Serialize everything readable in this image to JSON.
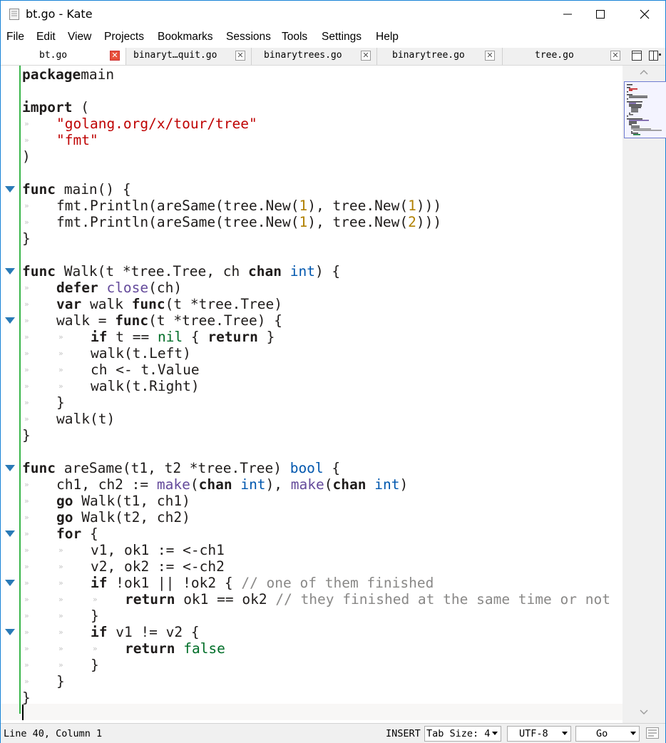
{
  "window": {
    "title": "bt.go  - Kate",
    "controls": {
      "minimize": "minimize",
      "maximize": "maximize",
      "close": "close"
    }
  },
  "menu": [
    "File",
    "Edit",
    "View",
    "Projects",
    "Bookmarks",
    "Sessions",
    "Tools",
    "Settings",
    "Help"
  ],
  "tabs": [
    {
      "label": "bt.go",
      "active": true
    },
    {
      "label": "binaryt…quit.go",
      "active": false
    },
    {
      "label": "binarytrees.go",
      "active": false
    },
    {
      "label": "binarytree.go",
      "active": false
    },
    {
      "label": "tree.go",
      "active": false
    }
  ],
  "editor": {
    "colors": {
      "keyword": "#1f1c1b",
      "string": "#bf0303",
      "number": "#b08000",
      "builtin": "#644a9b",
      "type": "#0057ae",
      "constant": "#006e28",
      "comment": "#898887",
      "fold_marker": "#2a7ab7",
      "modified_line": "#39b54a"
    },
    "lines": [
      {
        "indent": 0,
        "fold": false,
        "tokens": [
          [
            "kw",
            "package"
          ],
          [
            "",
            "main"
          ]
        ]
      },
      {
        "indent": 0,
        "fold": false,
        "tokens": []
      },
      {
        "indent": 0,
        "fold": false,
        "tokens": [
          [
            "kw",
            "import"
          ],
          [
            "",
            " ("
          ]
        ]
      },
      {
        "indent": 1,
        "fold": false,
        "tokens": [
          [
            "str",
            "\"golang.org/x/tour/tree\""
          ]
        ]
      },
      {
        "indent": 1,
        "fold": false,
        "tokens": [
          [
            "str",
            "\"fmt\""
          ]
        ]
      },
      {
        "indent": 0,
        "fold": false,
        "tokens": [
          [
            "",
            ")"
          ]
        ]
      },
      {
        "indent": 0,
        "fold": false,
        "tokens": []
      },
      {
        "indent": 0,
        "fold": true,
        "tokens": [
          [
            "kw",
            "func"
          ],
          [
            "",
            " main() {"
          ]
        ]
      },
      {
        "indent": 1,
        "fold": false,
        "tokens": [
          [
            "",
            "fmt.Println(areSame(tree.New("
          ],
          [
            "num",
            "1"
          ],
          [
            "",
            "), tree.New("
          ],
          [
            "num",
            "1"
          ],
          [
            "",
            ")))"
          ]
        ]
      },
      {
        "indent": 1,
        "fold": false,
        "tokens": [
          [
            "",
            "fmt.Println(areSame(tree.New("
          ],
          [
            "num",
            "1"
          ],
          [
            "",
            "), tree.New("
          ],
          [
            "num",
            "2"
          ],
          [
            "",
            ")))"
          ]
        ]
      },
      {
        "indent": 0,
        "fold": false,
        "tokens": [
          [
            "",
            "}"
          ]
        ]
      },
      {
        "indent": 0,
        "fold": false,
        "tokens": []
      },
      {
        "indent": 0,
        "fold": true,
        "tokens": [
          [
            "kw",
            "func"
          ],
          [
            "",
            " Walk(t *tree.Tree, ch "
          ],
          [
            "kw",
            "chan"
          ],
          [
            "",
            " "
          ],
          [
            "ty",
            "int"
          ],
          [
            "",
            ") {"
          ]
        ]
      },
      {
        "indent": 1,
        "fold": false,
        "tokens": [
          [
            "kw",
            "defer"
          ],
          [
            "",
            " "
          ],
          [
            "bi",
            "close"
          ],
          [
            "",
            "(ch)"
          ]
        ]
      },
      {
        "indent": 1,
        "fold": false,
        "tokens": [
          [
            "kw",
            "var"
          ],
          [
            "",
            " walk "
          ],
          [
            "kw",
            "func"
          ],
          [
            "",
            "(t *tree.Tree)"
          ]
        ]
      },
      {
        "indent": 1,
        "fold": true,
        "tokens": [
          [
            "",
            "walk = "
          ],
          [
            "kw",
            "func"
          ],
          [
            "",
            "(t *tree.Tree) {"
          ]
        ]
      },
      {
        "indent": 2,
        "fold": false,
        "tokens": [
          [
            "kw",
            "if"
          ],
          [
            "",
            " t == "
          ],
          [
            "con",
            "nil"
          ],
          [
            "",
            " { "
          ],
          [
            "kw",
            "return"
          ],
          [
            "",
            " }"
          ]
        ]
      },
      {
        "indent": 2,
        "fold": false,
        "tokens": [
          [
            "",
            "walk(t.Left)"
          ]
        ]
      },
      {
        "indent": 2,
        "fold": false,
        "tokens": [
          [
            "",
            "ch <- t.Value"
          ]
        ]
      },
      {
        "indent": 2,
        "fold": false,
        "tokens": [
          [
            "",
            "walk(t.Right)"
          ]
        ]
      },
      {
        "indent": 1,
        "fold": false,
        "tokens": [
          [
            "",
            "}"
          ]
        ]
      },
      {
        "indent": 1,
        "fold": false,
        "tokens": [
          [
            "",
            "walk(t)"
          ]
        ]
      },
      {
        "indent": 0,
        "fold": false,
        "tokens": [
          [
            "",
            "}"
          ]
        ]
      },
      {
        "indent": 0,
        "fold": false,
        "tokens": []
      },
      {
        "indent": 0,
        "fold": true,
        "tokens": [
          [
            "kw",
            "func"
          ],
          [
            "",
            " areSame(t1, t2 *tree.Tree) "
          ],
          [
            "ty",
            "bool"
          ],
          [
            "",
            " {"
          ]
        ]
      },
      {
        "indent": 1,
        "fold": false,
        "tokens": [
          [
            "",
            "ch1, ch2 := "
          ],
          [
            "bi",
            "make"
          ],
          [
            "",
            "("
          ],
          [
            "kw",
            "chan"
          ],
          [
            "",
            " "
          ],
          [
            "ty",
            "int"
          ],
          [
            "",
            "), "
          ],
          [
            "bi",
            "make"
          ],
          [
            "",
            "("
          ],
          [
            "kw",
            "chan"
          ],
          [
            "",
            " "
          ],
          [
            "ty",
            "int"
          ],
          [
            "",
            ")"
          ]
        ]
      },
      {
        "indent": 1,
        "fold": false,
        "tokens": [
          [
            "kw",
            "go"
          ],
          [
            "",
            " Walk(t1, ch1)"
          ]
        ]
      },
      {
        "indent": 1,
        "fold": false,
        "tokens": [
          [
            "kw",
            "go"
          ],
          [
            "",
            " Walk(t2, ch2)"
          ]
        ]
      },
      {
        "indent": 1,
        "fold": true,
        "tokens": [
          [
            "kw",
            "for"
          ],
          [
            "",
            " {"
          ]
        ]
      },
      {
        "indent": 2,
        "fold": false,
        "tokens": [
          [
            "",
            "v1, ok1 := <-ch1"
          ]
        ]
      },
      {
        "indent": 2,
        "fold": false,
        "tokens": [
          [
            "",
            "v2, ok2 := <-ch2"
          ]
        ]
      },
      {
        "indent": 2,
        "fold": true,
        "tokens": [
          [
            "kw",
            "if"
          ],
          [
            "",
            " !ok1 || !ok2 { "
          ],
          [
            "cm",
            "// one of them finished"
          ]
        ]
      },
      {
        "indent": 3,
        "fold": false,
        "tokens": [
          [
            "kw",
            "return"
          ],
          [
            "",
            " ok1 == ok2 "
          ],
          [
            "cm",
            "// they finished at the same time or not"
          ]
        ]
      },
      {
        "indent": 2,
        "fold": false,
        "tokens": [
          [
            "",
            "}"
          ]
        ]
      },
      {
        "indent": 2,
        "fold": true,
        "tokens": [
          [
            "kw",
            "if"
          ],
          [
            "",
            " v1 != v2 {"
          ]
        ]
      },
      {
        "indent": 3,
        "fold": false,
        "tokens": [
          [
            "kw",
            "return"
          ],
          [
            "",
            " "
          ],
          [
            "con",
            "false"
          ]
        ]
      },
      {
        "indent": 2,
        "fold": false,
        "tokens": [
          [
            "",
            "}"
          ]
        ]
      },
      {
        "indent": 1,
        "fold": false,
        "tokens": [
          [
            "",
            "}"
          ]
        ]
      },
      {
        "indent": 0,
        "fold": false,
        "tokens": [
          [
            "",
            "}"
          ]
        ]
      },
      {
        "indent": 0,
        "fold": false,
        "tokens": []
      }
    ]
  },
  "status": {
    "position": "Line 40, Column 1",
    "mode": "INSERT",
    "tab_size": "Tab Size: 4",
    "encoding": "UTF-8",
    "syntax": "Go"
  }
}
